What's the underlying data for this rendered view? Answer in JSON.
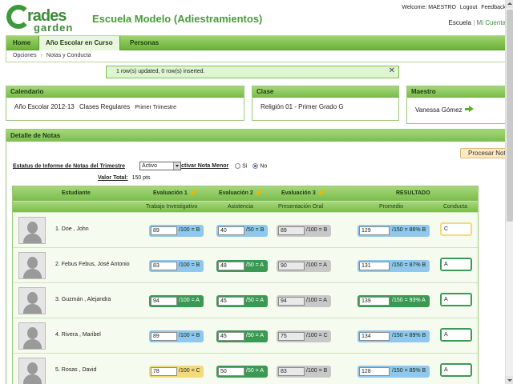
{
  "app": {
    "title": "Escuela Modelo (Adiestramientos)",
    "logo_word1": "rades",
    "logo_word2": "garden"
  },
  "toplinks": {
    "welcome": "Welcome: MAESTRO",
    "logout": "Logout",
    "feedback": "Feedback",
    "escuela": "Escuela",
    "separator": "|",
    "mi_cuenta": "Mi Cuenta"
  },
  "nav": {
    "tabs": [
      "Home",
      "Año Escolar en Curso",
      "Personas"
    ],
    "active_tab": 1,
    "breadcrumb": [
      "Opciones",
      "Notas y Conducta"
    ]
  },
  "message": {
    "text": "1 row(s) updated, 0 row(s) inserted.",
    "close": "✕"
  },
  "calendario": {
    "title": "Calendario",
    "year": "Año Escolar 2012-13",
    "classes": "Clases Regulares",
    "term": "Primer Trimestre"
  },
  "clase": {
    "title": "Clase",
    "value": "Religión 01 -  Primer Grado  G"
  },
  "maestro": {
    "title": "Maestro",
    "value": "Vanessa Gómez"
  },
  "detalle": {
    "title": "Detalle de Notas",
    "procesar": "Procesar Not",
    "estatus_label": "Estatus de Informe de Notas del Trimestre",
    "estatus_value": "Activo",
    "inactivar_label": "Inactivar Nota Menor",
    "si": "Si",
    "no": "No",
    "valor_total_label": "Valor Total:",
    "valor_total_value": "150 pts"
  },
  "grid": {
    "headers1": {
      "estudiante": "Estudiante",
      "eval1": "Evaluación 1",
      "eval2": "Evaluación 2",
      "eval3": "Evaluación 3",
      "resultado": "RESULTADO"
    },
    "headers2": {
      "e1": "Trabajo Investigativo",
      "e2": "Asistencia",
      "e3": "Presentación Oral",
      "promedio": "Promedio",
      "conducta": "Conducta"
    },
    "rows": [
      {
        "name": "1. Doe , John",
        "e1": "89",
        "e1s": "/100 = B",
        "e2": "40",
        "e2s": "/50 = B",
        "e3": "89",
        "e3s": "/100 = B",
        "p": "129",
        "ps": "/150 = 86% B",
        "c": "C"
      },
      {
        "name": "2. Febus Febus, José Antonio",
        "e1": "83",
        "e1s": "/100 = B",
        "e2": "48",
        "e2s": "/50 = A",
        "e3": "90",
        "e3s": "/100 = A",
        "p": "131",
        "ps": "/150 = 87% B",
        "c": "A"
      },
      {
        "name": "3. Guzmán , Alejandra",
        "e1": "94",
        "e1s": "/100 = A",
        "e2": "45",
        "e2s": "/50 = A",
        "e3": "94",
        "e3s": "/100 = A",
        "p": "139",
        "ps": "/150 = 93% A",
        "c": "A"
      },
      {
        "name": "4. Rivera , Maribel",
        "e1": "89",
        "e1s": "/100 = B",
        "e2": "45",
        "e2s": "/50 = A",
        "e3": "75",
        "e3s": "/100 = C",
        "p": "134",
        "ps": "/150 = 89% B",
        "c": "A"
      },
      {
        "name": "5. Rosas , David",
        "e1": "78",
        "e1s": "/100 = C",
        "e2": "50",
        "e2s": "/50 = A",
        "e3": "83",
        "e3s": "/100 = B",
        "p": "128",
        "ps": "/150 = 85% B",
        "c": "A"
      }
    ]
  }
}
